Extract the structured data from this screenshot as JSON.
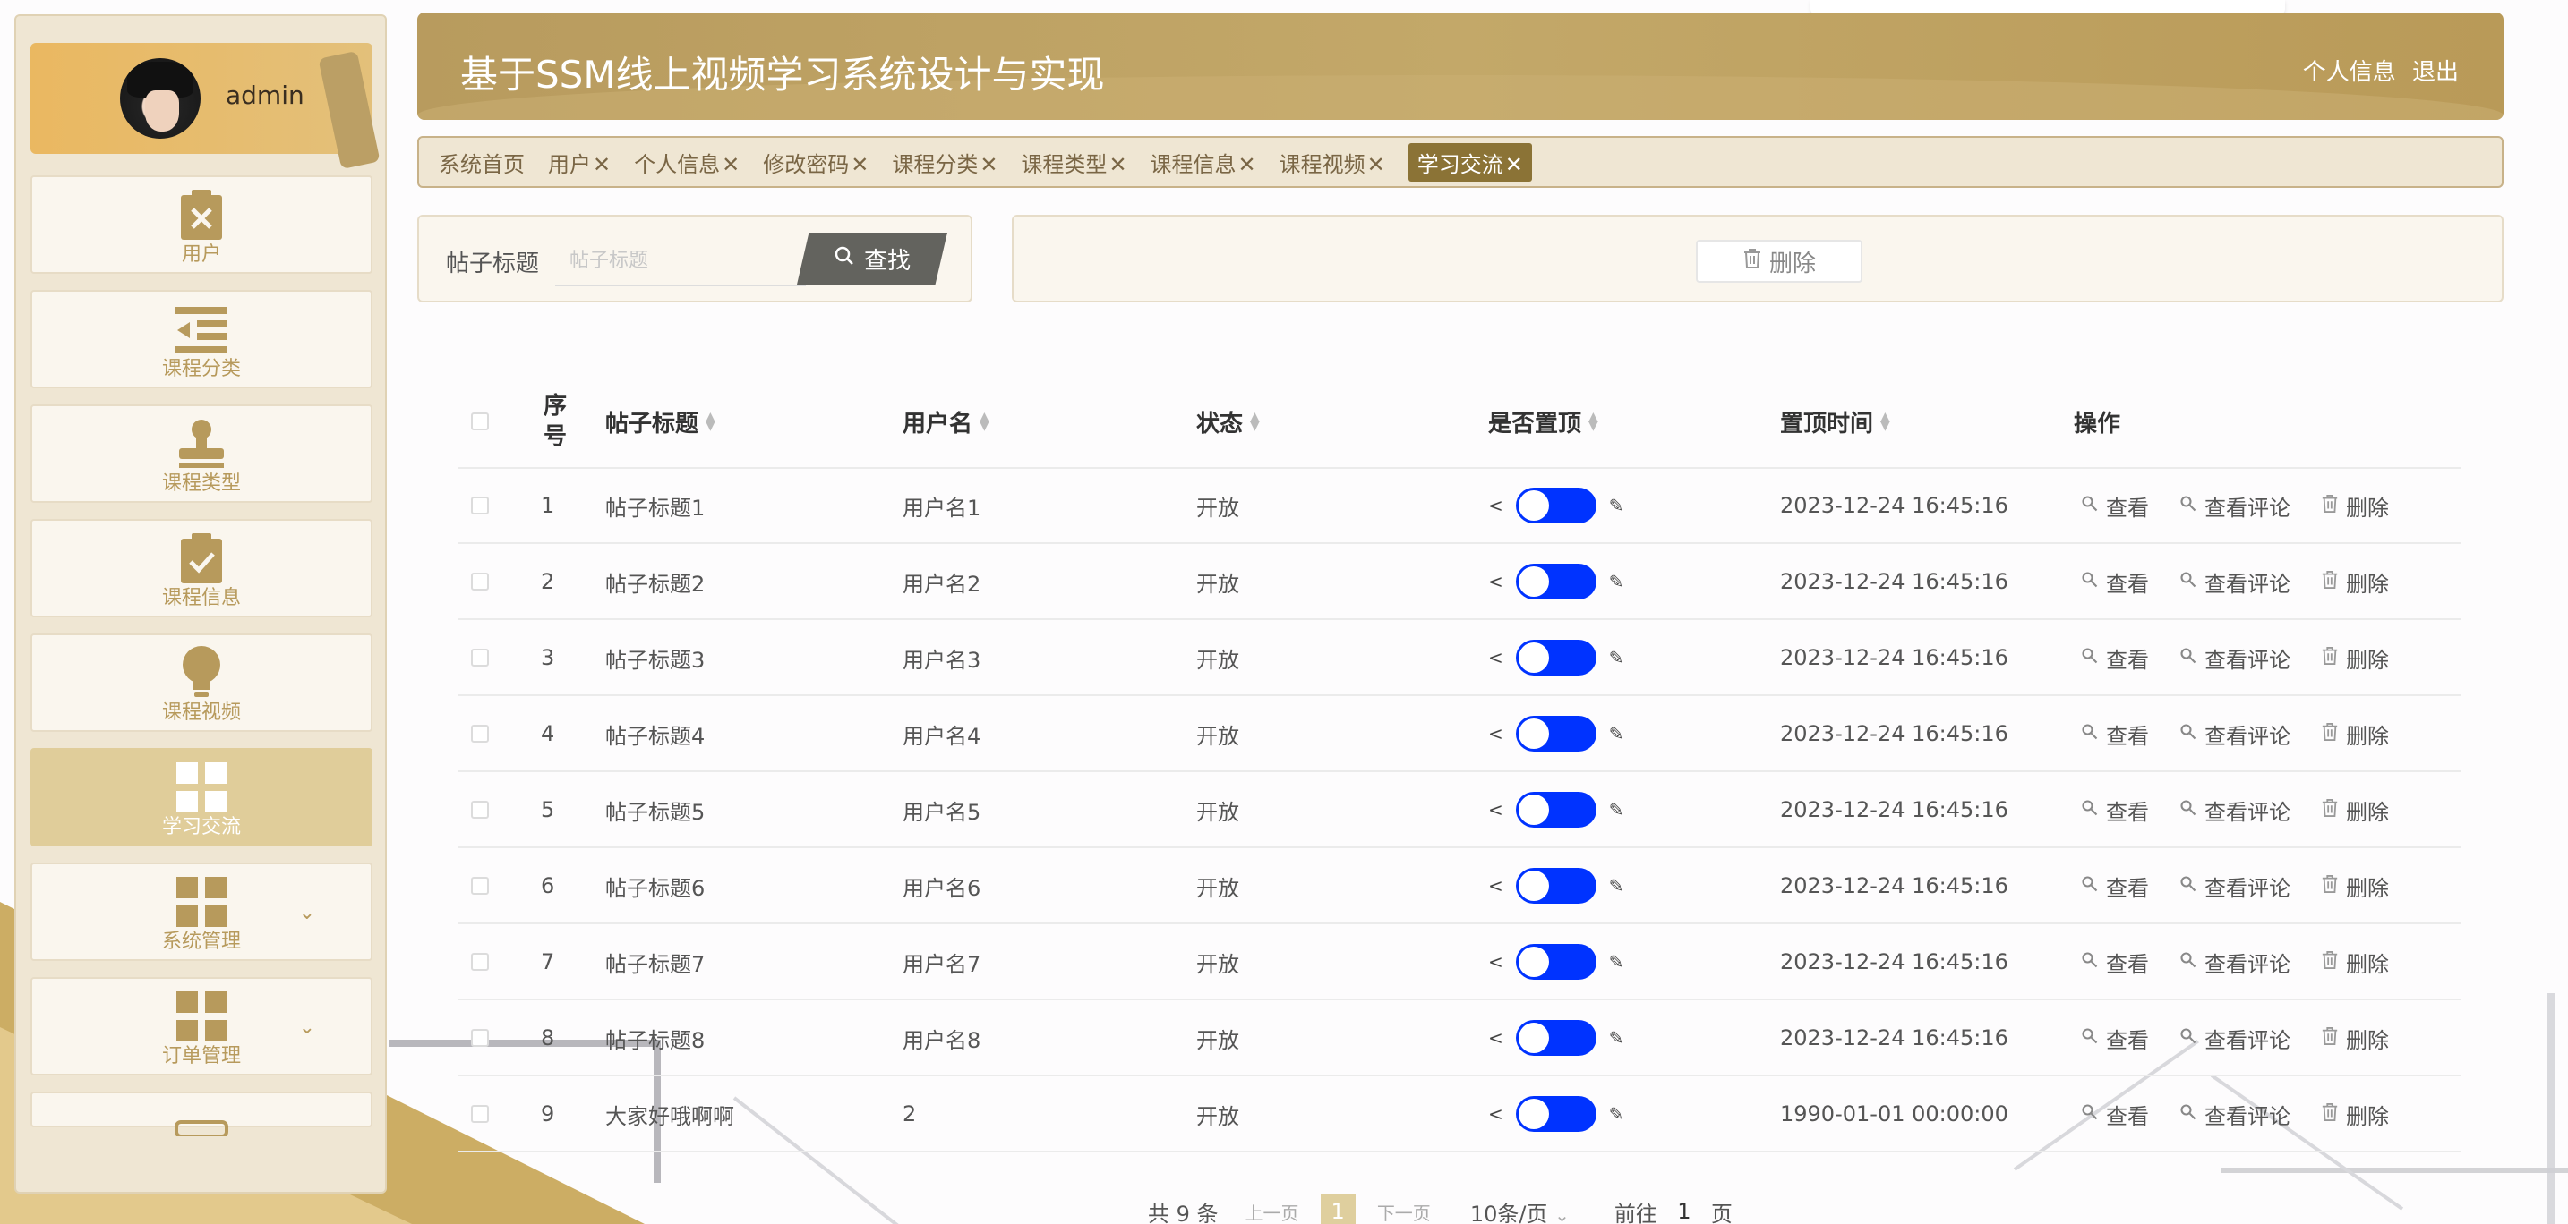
{
  "profile": {
    "username": "admin"
  },
  "sidebar": {
    "items": [
      {
        "label": "用户",
        "icon": "clipboard-x-icon",
        "active": false
      },
      {
        "label": "课程分类",
        "icon": "list-indent-icon",
        "active": false
      },
      {
        "label": "课程类型",
        "icon": "stamp-icon",
        "active": false
      },
      {
        "label": "课程信息",
        "icon": "clipboard-check-icon",
        "active": false
      },
      {
        "label": "课程视频",
        "icon": "lightbulb-icon",
        "active": false
      },
      {
        "label": "学习交流",
        "icon": "grid-icon",
        "active": true
      },
      {
        "label": "系统管理",
        "icon": "grid-icon",
        "active": false,
        "expandable": true
      },
      {
        "label": "订单管理",
        "icon": "grid-icon",
        "active": false,
        "expandable": true
      }
    ]
  },
  "header": {
    "title": "基于SSM线上视频学习系统设计与实现",
    "profile_link": "个人信息",
    "logout_link": "退出"
  },
  "tabs": [
    {
      "label": "系统首页",
      "closable": false,
      "active": false
    },
    {
      "label": "用户",
      "closable": true,
      "active": false
    },
    {
      "label": "个人信息",
      "closable": true,
      "active": false
    },
    {
      "label": "修改密码",
      "closable": true,
      "active": false
    },
    {
      "label": "课程分类",
      "closable": true,
      "active": false
    },
    {
      "label": "课程类型",
      "closable": true,
      "active": false
    },
    {
      "label": "课程信息",
      "closable": true,
      "active": false
    },
    {
      "label": "课程视频",
      "closable": true,
      "active": false
    },
    {
      "label": "学习交流",
      "closable": true,
      "active": true
    }
  ],
  "search": {
    "label": "帖子标题",
    "placeholder": "帖子标题",
    "value": "",
    "button": "查找"
  },
  "toolbar": {
    "delete_label": "删除"
  },
  "table": {
    "headers": {
      "index": "序号",
      "title": "帖子标题",
      "user": "用户名",
      "status": "状态",
      "pinned": "是否置顶",
      "pin_time": "置顶时间",
      "actions": "操作"
    },
    "rows": [
      {
        "index": "1",
        "title": "帖子标题1",
        "user": "用户名1",
        "status": "开放",
        "pinned": true,
        "pin_time": "2023-12-24 16:45:16"
      },
      {
        "index": "2",
        "title": "帖子标题2",
        "user": "用户名2",
        "status": "开放",
        "pinned": true,
        "pin_time": "2023-12-24 16:45:16"
      },
      {
        "index": "3",
        "title": "帖子标题3",
        "user": "用户名3",
        "status": "开放",
        "pinned": true,
        "pin_time": "2023-12-24 16:45:16"
      },
      {
        "index": "4",
        "title": "帖子标题4",
        "user": "用户名4",
        "status": "开放",
        "pinned": true,
        "pin_time": "2023-12-24 16:45:16"
      },
      {
        "index": "5",
        "title": "帖子标题5",
        "user": "用户名5",
        "status": "开放",
        "pinned": true,
        "pin_time": "2023-12-24 16:45:16"
      },
      {
        "index": "6",
        "title": "帖子标题6",
        "user": "用户名6",
        "status": "开放",
        "pinned": true,
        "pin_time": "2023-12-24 16:45:16"
      },
      {
        "index": "7",
        "title": "帖子标题7",
        "user": "用户名7",
        "status": "开放",
        "pinned": true,
        "pin_time": "2023-12-24 16:45:16"
      },
      {
        "index": "8",
        "title": "帖子标题8",
        "user": "用户名8",
        "status": "开放",
        "pinned": true,
        "pin_time": "2023-12-24 16:45:16"
      },
      {
        "index": "9",
        "title": "大家好哦啊啊",
        "user": "2",
        "status": "开放",
        "pinned": true,
        "pin_time": "1990-01-01 00:00:00"
      }
    ],
    "row_actions": {
      "view": "查看",
      "view_comments": "查看评论",
      "delete": "删除"
    }
  },
  "pagination": {
    "total": "共 9 条",
    "prev": "上一页",
    "current": "1",
    "next": "下一页",
    "page_size": "10条/页",
    "goto_prefix": "前往",
    "goto_value": "1",
    "goto_suffix": "页"
  },
  "colors": {
    "accent": "#b89b5e",
    "active_tab": "#8b7336",
    "toggle_on": "#0033ff",
    "sidebar_bg": "#efe6d3"
  }
}
